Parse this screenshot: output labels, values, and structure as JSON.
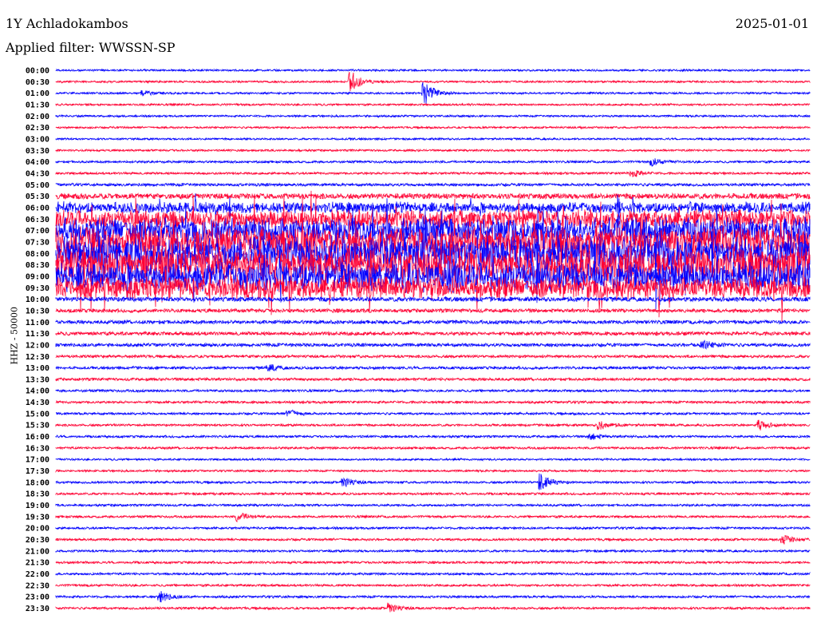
{
  "header": {
    "station": "1Y Achladokambos",
    "date": "2025-01-01",
    "filter": "Applied filter: WWSSN-SP"
  },
  "chart_data": {
    "type": "line",
    "title": "1Y Achladokambos",
    "subtitle": "Applied filter: WWSSN-SP",
    "ylabel": "HHZ - 50000",
    "xlabel": "",
    "row_minutes": 30,
    "colors": [
      "#0000ff",
      "#ff0033"
    ],
    "row_labels": [
      "00:00",
      "00:30",
      "01:00",
      "01:30",
      "02:00",
      "02:30",
      "03:00",
      "03:30",
      "04:00",
      "04:30",
      "05:00",
      "05:30",
      "06:00",
      "06:30",
      "07:00",
      "07:30",
      "08:00",
      "08:30",
      "09:00",
      "09:30",
      "10:00",
      "10:30",
      "11:00",
      "11:30",
      "12:00",
      "12:30",
      "13:00",
      "13:30",
      "14:00",
      "14:30",
      "15:00",
      "15:30",
      "16:00",
      "16:30",
      "17:00",
      "17:30",
      "18:00",
      "18:30",
      "19:00",
      "19:30",
      "20:00",
      "20:30",
      "21:00",
      "21:30",
      "22:00",
      "22:30",
      "23:00",
      "23:30"
    ],
    "row_noise_level": [
      1,
      1,
      1,
      1,
      1,
      1,
      1,
      1,
      1.2,
      1.2,
      1.5,
      3,
      6,
      10,
      14,
      16,
      18,
      18,
      16,
      12,
      2.5,
      2,
      2,
      2,
      1.8,
      1.5,
      1.5,
      1.5,
      1.3,
      1.3,
      1.2,
      1.2,
      1.2,
      1.2,
      1,
      1,
      1.2,
      1.2,
      1.2,
      1.2,
      1.2,
      1.2,
      1.2,
      1.2,
      1.2,
      1.2,
      1.2,
      1.2
    ],
    "events": [
      {
        "row": 1,
        "minute": 11.8,
        "amp": 12
      },
      {
        "row": 2,
        "minute": 14.7,
        "amp": 14
      },
      {
        "row": 2,
        "minute": 3.5,
        "amp": 3
      },
      {
        "row": 8,
        "minute": 23.8,
        "amp": 4
      },
      {
        "row": 9,
        "minute": 23,
        "amp": 4
      },
      {
        "row": 24,
        "minute": 25.8,
        "amp": 5
      },
      {
        "row": 26,
        "minute": 8.5,
        "amp": 4
      },
      {
        "row": 30,
        "minute": 9.3,
        "amp": 5
      },
      {
        "row": 31,
        "minute": 21.7,
        "amp": 5
      },
      {
        "row": 31,
        "minute": 28,
        "amp": 6
      },
      {
        "row": 32,
        "minute": 21.3,
        "amp": 4
      },
      {
        "row": 36,
        "minute": 11.5,
        "amp": 6
      },
      {
        "row": 36,
        "minute": 19.3,
        "amp": 10
      },
      {
        "row": 39,
        "minute": 7.3,
        "amp": 5
      },
      {
        "row": 41,
        "minute": 29,
        "amp": 5
      },
      {
        "row": 46,
        "minute": 4.2,
        "amp": 6
      },
      {
        "row": 47,
        "minute": 13.3,
        "amp": 6
      }
    ]
  }
}
